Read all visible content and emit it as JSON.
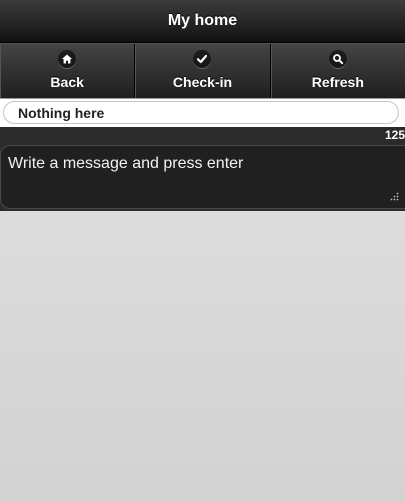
{
  "header": {
    "title": "My home"
  },
  "navbar": {
    "items": [
      {
        "label": "Back",
        "icon": "home-icon"
      },
      {
        "label": "Check-in",
        "icon": "check-icon"
      },
      {
        "label": "Refresh",
        "icon": "search-icon"
      }
    ]
  },
  "status": {
    "text": "Nothing here"
  },
  "composer": {
    "counter": "125",
    "placeholder": "Write a message and press enter"
  },
  "colors": {
    "header": "#1f1f1f",
    "page_background": "#d6d6d6",
    "composer_background": "#202020"
  }
}
